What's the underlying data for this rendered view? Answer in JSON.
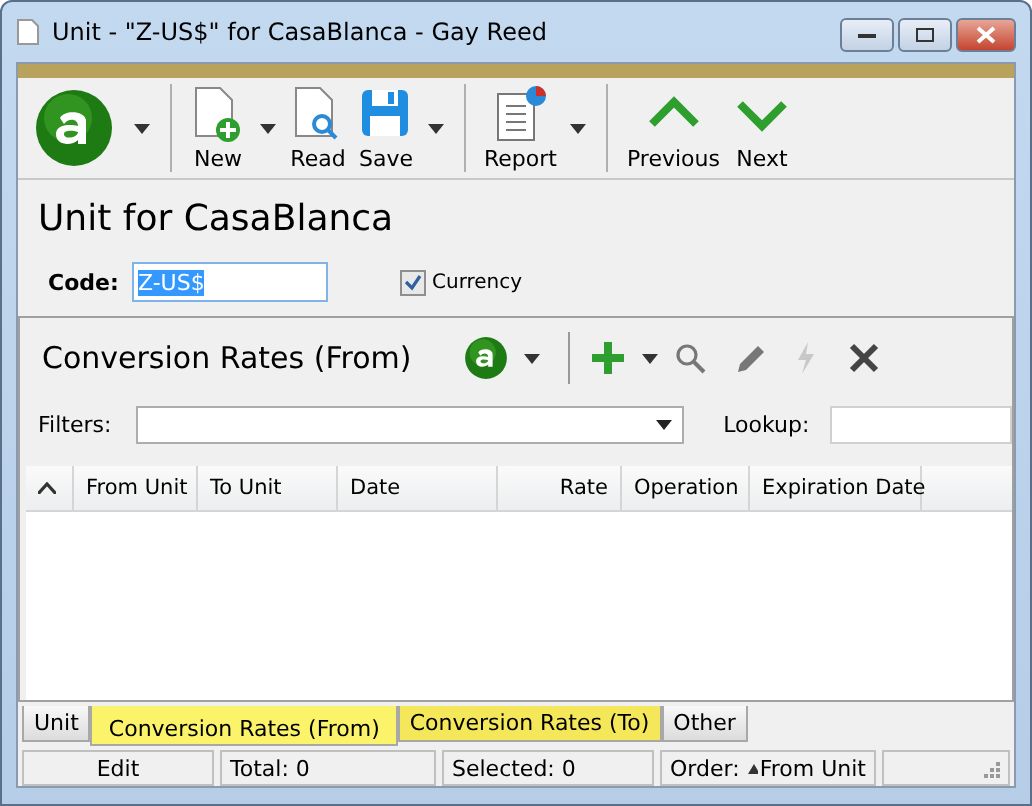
{
  "window": {
    "title": "Unit - \"Z-US$\" for CasaBlanca - Gay Reed"
  },
  "toolbar": {
    "buttons": [
      {
        "label": "New",
        "kind": "new",
        "dropdown": true
      },
      {
        "label": "Read",
        "kind": "read",
        "dropdown": false
      },
      {
        "label": "Save",
        "kind": "save",
        "dropdown": true
      },
      {
        "label": "Report",
        "kind": "report",
        "dropdown": true
      },
      {
        "label": "Previous",
        "kind": "previous",
        "dropdown": false
      },
      {
        "label": "Next",
        "kind": "next",
        "dropdown": false
      }
    ]
  },
  "heading": "Unit for CasaBlanca",
  "code": {
    "label": "Code:",
    "value": "Z-US$"
  },
  "currency": {
    "label": "Currency",
    "checked": true
  },
  "panel": {
    "title": "Conversion Rates (From)",
    "filters_label": "Filters:",
    "lookup_label": "Lookup:",
    "columns": [
      "From Unit",
      "To Unit",
      "Date",
      "Rate",
      "Operation",
      "Expiration Date"
    ]
  },
  "tabs": [
    {
      "label": "Unit",
      "selected": false,
      "highlighted": false
    },
    {
      "label": "Conversion Rates (From)",
      "selected": true,
      "highlighted": true
    },
    {
      "label": "Conversion Rates (To)",
      "selected": false,
      "highlighted": true
    },
    {
      "label": "Other",
      "selected": false,
      "highlighted": false
    }
  ],
  "status_bar": {
    "mode": "Edit",
    "total": "Total: 0",
    "selected": "Selected: 0",
    "order_label": "Order:",
    "order_value": "From Unit"
  }
}
